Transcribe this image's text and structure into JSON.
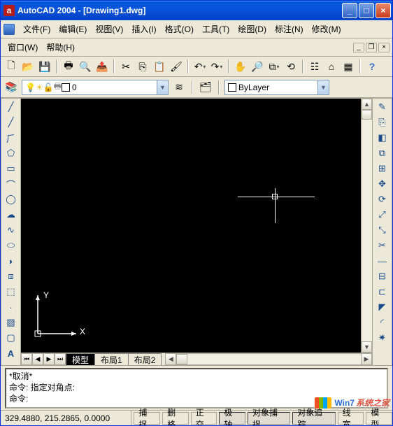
{
  "title": "AutoCAD 2004 - [Drawing1.dwg]",
  "appicon_letter": "a",
  "menu": {
    "file": "文件(F)",
    "edit": "编辑(E)",
    "view": "视图(V)",
    "insert": "插入(I)",
    "format": "格式(O)",
    "tools": "工具(T)",
    "draw": "绘图(D)",
    "dimension": "标注(N)",
    "modify": "修改(M)",
    "window": "窗口(W)",
    "help": "帮助(H)"
  },
  "layer": {
    "current": "0",
    "color_label": "ByLayer"
  },
  "tabs": {
    "model": "模型",
    "layout1": "布局1",
    "layout2": "布局2"
  },
  "command": {
    "line1": "*取消*",
    "line2": "命令: 指定对角点:",
    "line3": "命令:"
  },
  "status": {
    "coords": "329.4880, 215.2865, 0.0000",
    "snap": "捕捉",
    "grid": "删格",
    "ortho": "正交",
    "polar": "极轴",
    "osnap": "对象捕捉",
    "otrack": "对象追踪",
    "lwt": "线宽",
    "model": "模型"
  },
  "ucs": {
    "x": "X",
    "y": "Y"
  },
  "watermark": {
    "blue": "Win7",
    "red": "系统之家"
  }
}
